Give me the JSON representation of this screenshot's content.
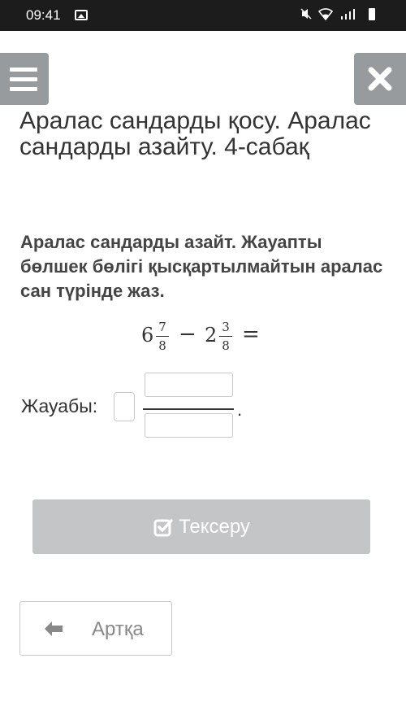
{
  "status_bar": {
    "time": "09:41",
    "icons": [
      "gallery-icon",
      "mute-icon",
      "wifi-icon",
      "signal-icon",
      "battery-icon"
    ]
  },
  "header": {
    "menu_icon": "hamburger-menu-icon",
    "close_icon": "close-x-icon",
    "button_color": "#979b9e"
  },
  "lesson": {
    "title": "Аралас сандарды қосу. Аралас сандарды азайту. 4-сабақ"
  },
  "task": {
    "instruction": "Аралас сандарды азайт. Жауапты бөлшек бөлігі қысқартылмайтын аралас сан түрінде жаз.",
    "equation": {
      "first_whole": "6",
      "first_num": "7",
      "first_den": "8",
      "operator": "−",
      "second_whole": "2",
      "second_num": "3",
      "second_den": "8",
      "equals": "="
    },
    "answer_label": "Жауабы:",
    "answer_whole": "",
    "answer_numerator": "",
    "answer_denominator": "",
    "period": "."
  },
  "buttons": {
    "check_label": "Тексеру",
    "check_icon": "checkbox-check-icon",
    "check_color": "#c4c5c6",
    "back_label": "Артқа",
    "back_icon": "arrow-left-icon"
  }
}
